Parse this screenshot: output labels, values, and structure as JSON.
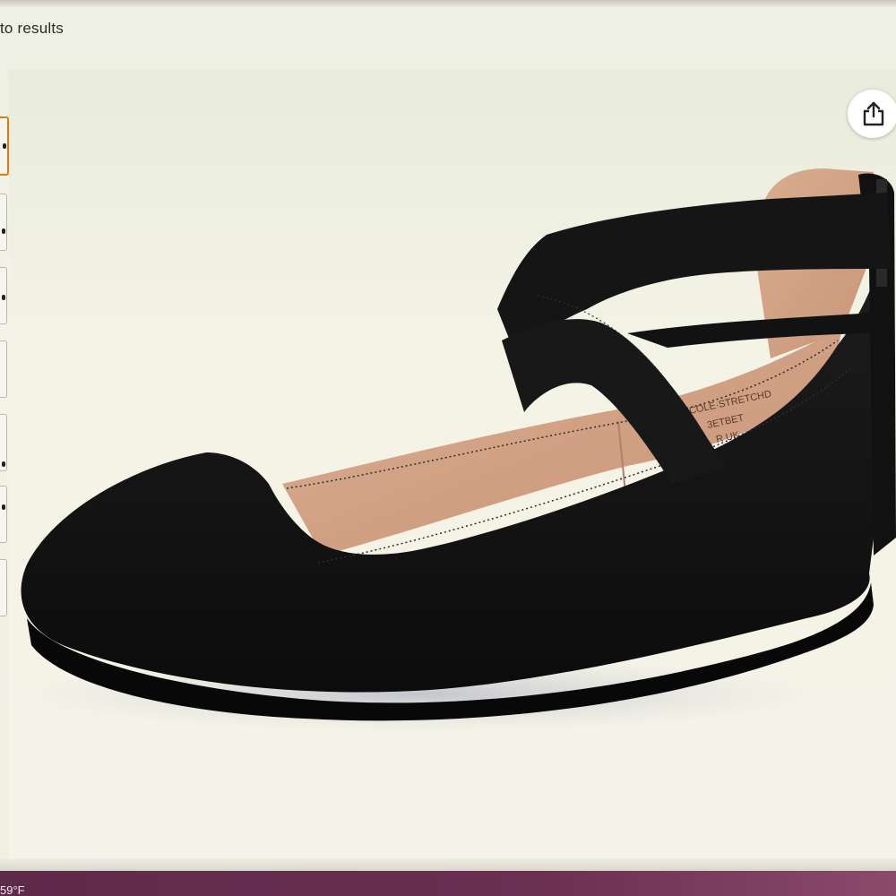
{
  "header": {
    "back_link": "to results"
  },
  "product": {
    "insole_print": [
      "COLE·STRETCHD",
      "3ETBET",
      "R UK"
    ],
    "color": "#141414"
  },
  "controls": {
    "share_icon": "share-icon"
  },
  "thumbnails": {
    "count": 7,
    "active_index": 0,
    "accent": "#e47911"
  },
  "taskbar": {
    "weather_temp": "59°F"
  }
}
